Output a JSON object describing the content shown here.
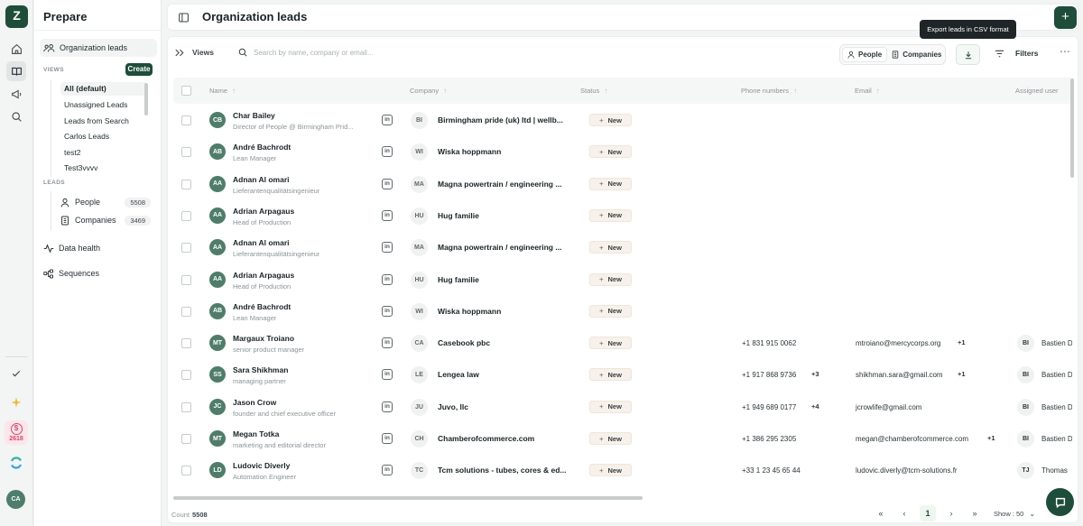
{
  "app": {
    "logo_letter": "Z",
    "credits": "2618",
    "user_initials": "CA"
  },
  "sidebar": {
    "title": "Prepare",
    "org_leads_label": "Organization leads",
    "views_caption": "VIEWS",
    "create_label": "Create",
    "views": [
      "All (default)",
      "Unassigned Leads",
      "Leads from Search",
      "Carlos Leads",
      "test2",
      "Test3vvvv"
    ],
    "leads_caption": "LEADS",
    "people_label": "People",
    "people_count": "5508",
    "companies_label": "Companies",
    "companies_count": "3469",
    "data_health_label": "Data health",
    "sequences_label": "Sequences"
  },
  "header": {
    "title": "Organization leads"
  },
  "toolbar": {
    "views_label": "Views",
    "search_placeholder": "Search by name, company or email...",
    "people_tab": "People",
    "companies_tab": "Companies",
    "export_tooltip": "Export leads in CSV format",
    "filters_label": "Filters",
    "more_label": "⋯"
  },
  "table": {
    "columns": [
      "Name",
      "Company",
      "Status",
      "Phone numbers",
      "Email",
      "Assigned user"
    ],
    "rows": [
      {
        "initials": "CB",
        "name": "Char Bailey",
        "title": "Director of People @ Birmingham Prid...",
        "li": "in",
        "co_initials": "BI",
        "company": "Birmingham pride (uk) ltd | wellb...",
        "status": "New",
        "phone": "",
        "phone_more": "",
        "email": "",
        "email_more": "",
        "user_initials": "",
        "user": ""
      },
      {
        "initials": "AB",
        "name": "André Bachrodt",
        "title": "Lean Manager",
        "li": "in",
        "co_initials": "WI",
        "company": "Wiska hoppmann",
        "status": "New",
        "phone": "",
        "phone_more": "",
        "email": "",
        "email_more": "",
        "user_initials": "",
        "user": ""
      },
      {
        "initials": "AA",
        "name": "Adnan Al omari",
        "title": "Lieferantenqualitätsingenieur",
        "li": "in",
        "co_initials": "MA",
        "company": "Magna powertrain / engineering ...",
        "status": "New",
        "phone": "",
        "phone_more": "",
        "email": "",
        "email_more": "",
        "user_initials": "",
        "user": ""
      },
      {
        "initials": "AA",
        "name": "Adrian Arpagaus",
        "title": "Head of Production",
        "li": "in",
        "co_initials": "HU",
        "company": "Hug familie",
        "status": "New",
        "phone": "",
        "phone_more": "",
        "email": "",
        "email_more": "",
        "user_initials": "",
        "user": ""
      },
      {
        "initials": "AA",
        "name": "Adnan Al omari",
        "title": "Lieferantenqualitätsingenieur",
        "li": "in",
        "co_initials": "MA",
        "company": "Magna powertrain / engineering ...",
        "status": "New",
        "phone": "",
        "phone_more": "",
        "email": "",
        "email_more": "",
        "user_initials": "",
        "user": ""
      },
      {
        "initials": "AA",
        "name": "Adrian Arpagaus",
        "title": "Head of Production",
        "li": "in",
        "co_initials": "HU",
        "company": "Hug familie",
        "status": "New",
        "phone": "",
        "phone_more": "",
        "email": "",
        "email_more": "",
        "user_initials": "",
        "user": ""
      },
      {
        "initials": "AB",
        "name": "André Bachrodt",
        "title": "Lean Manager",
        "li": "in",
        "co_initials": "WI",
        "company": "Wiska hoppmann",
        "status": "New",
        "phone": "",
        "phone_more": "",
        "email": "",
        "email_more": "",
        "user_initials": "",
        "user": ""
      },
      {
        "initials": "MT",
        "name": "Margaux Troiano",
        "title": "senior product manager",
        "li": "in",
        "co_initials": "CA",
        "company": "Casebook pbc",
        "status": "New",
        "phone": "+1 831 915 0062",
        "phone_more": "",
        "email": "mtroiano@mercycorps.org",
        "email_more": "+1",
        "user_initials": "BI",
        "user": "Bastien D"
      },
      {
        "initials": "SS",
        "name": "Sara Shikhman",
        "title": "managing partner",
        "li": "in",
        "co_initials": "LE",
        "company": "Lengea law",
        "status": "New",
        "phone": "+1 917 868 9736",
        "phone_more": "+3",
        "email": "shikhman.sara@gmail.com",
        "email_more": "+1",
        "user_initials": "BI",
        "user": "Bastien D"
      },
      {
        "initials": "JC",
        "name": "Jason Crow",
        "title": "founder and chief executive officer",
        "li": "in",
        "co_initials": "JU",
        "company": "Juvo, llc",
        "status": "New",
        "phone": "+1 949 689 0177",
        "phone_more": "+4",
        "email": "jcrowlife@gmail.com",
        "email_more": "",
        "user_initials": "BI",
        "user": "Bastien D"
      },
      {
        "initials": "MT",
        "name": "Megan Totka",
        "title": "marketing and editorial director",
        "li": "in",
        "co_initials": "CH",
        "company": "Chamberofcommerce.com",
        "status": "New",
        "phone": "+1 386 295 2305",
        "phone_more": "",
        "email": "megan@chamberofcommerce.com",
        "email_more": "+1",
        "user_initials": "BI",
        "user": "Bastien D"
      },
      {
        "initials": "LD",
        "name": "Ludovic Diverly",
        "title": "Automation Engineer",
        "li": "in",
        "co_initials": "TC",
        "company": "Tcm solutions - tubes, cores & ed...",
        "status": "New",
        "phone": "+33 1 23 45 65 44",
        "phone_more": "",
        "email": "ludovic.diverly@tcm-solutions.fr",
        "email_more": "",
        "user_initials": "TJ",
        "user": "Thomas"
      }
    ]
  },
  "footer": {
    "count_label": "Count",
    "count_value": "5508",
    "page_current": "1",
    "show_label": "Show : 50"
  },
  "colors": {
    "brand": "#1e4d3a",
    "accent_pink": "#d9466e"
  }
}
